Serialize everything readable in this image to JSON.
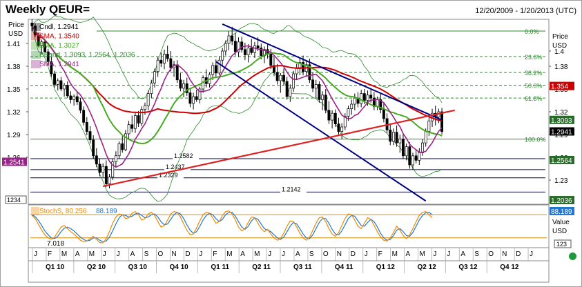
{
  "header": {
    "title": "Weekly QEUR=",
    "date_range": "12/20/2009 - 1/20/2013 (UTC)"
  },
  "colors": {
    "candles": "#000000",
    "sma_red": "#cc0000",
    "sma_green": "#44aa22",
    "sma_purple": "#992288",
    "bollinger": "#2a8a2a",
    "channel": "#000080",
    "trendline": "#dd2222",
    "fib_line": "#2a8a2a",
    "stoch_k": "#ee8800",
    "stoch_d": "#2277cc",
    "status_dot": "#1e9a3a"
  },
  "chart_data": [
    {
      "type": "line",
      "name": "price",
      "title": "Weekly QEUR=",
      "ylabel": "Price USD",
      "ylim": [
        1.2,
        1.44
      ],
      "yticks": [
        "1.41",
        "1.38",
        "1.35",
        "1.32",
        "1.29",
        "1.26"
      ],
      "yticks_right": [
        "1.4",
        "1.38",
        "1.35",
        "1.32",
        "1.29",
        "1.26",
        "1.23"
      ],
      "legend": [
        {
          "label": "Cndl, 1.2941",
          "color": "#000000"
        },
        {
          "label": "SMA, 1.3540",
          "color": "#cc0000"
        },
        {
          "label": "SMA, 1.3027",
          "color": "#44aa22"
        },
        {
          "label": "BBand, 1.3093, 1.2564, 1.2036",
          "color": "#2a8a2a"
        },
        {
          "label": "SMA, 1.2941",
          "color": "#992288"
        }
      ],
      "fibonacci": [
        {
          "label": "0.0%",
          "value": 1.4264
        },
        {
          "label": "23.6%",
          "value": 1.3927
        },
        {
          "label": "38.2%",
          "value": 1.3718
        },
        {
          "label": "50.0%",
          "value": 1.3549
        },
        {
          "label": "61.8%",
          "value": 1.3381
        },
        {
          "label": "100.0%",
          "value": 1.284
        }
      ],
      "support_levels": [
        {
          "label": "1.2582",
          "value": 1.2582
        },
        {
          "label": "1.2437",
          "value": 1.2437
        },
        {
          "label": "1.2329",
          "value": 1.2329
        },
        {
          "label": "1.2142",
          "value": 1.2142
        }
      ],
      "right_badges": [
        {
          "label": "1.354",
          "value": 1.354,
          "bg": "#cc0000",
          "fg": "#ffffff"
        },
        {
          "label": "1.3093",
          "value": 1.3093,
          "bg": "#2a6a2a",
          "fg": "#ffffff"
        },
        {
          "label": "1.2941",
          "value": 1.2941,
          "bg": "#000000",
          "fg": "#ffffff"
        },
        {
          "label": "1.2564",
          "value": 1.2564,
          "bg": "#2a6a2a",
          "fg": "#ffffff"
        },
        {
          "label": "1.2036",
          "value": 1.2036,
          "bg": "#2a6a2a",
          "fg": "#ffffff"
        }
      ],
      "left_badge": {
        "label": "1.2541",
        "value": 1.2541
      },
      "corner_box": "1234",
      "candles": [
        [
          1.437,
          1.442,
          1.425,
          1.433
        ],
        [
          1.433,
          1.436,
          1.418,
          1.421
        ],
        [
          1.421,
          1.424,
          1.405,
          1.407
        ],
        [
          1.407,
          1.415,
          1.396,
          1.412
        ],
        [
          1.412,
          1.416,
          1.396,
          1.399
        ],
        [
          1.399,
          1.403,
          1.382,
          1.386
        ],
        [
          1.386,
          1.392,
          1.366,
          1.37
        ],
        [
          1.37,
          1.374,
          1.352,
          1.356
        ],
        [
          1.356,
          1.364,
          1.348,
          1.361
        ],
        [
          1.361,
          1.366,
          1.347,
          1.35
        ],
        [
          1.35,
          1.358,
          1.34,
          1.355
        ],
        [
          1.355,
          1.36,
          1.338,
          1.341
        ],
        [
          1.341,
          1.347,
          1.331,
          1.336
        ],
        [
          1.336,
          1.343,
          1.328,
          1.34
        ],
        [
          1.34,
          1.346,
          1.329,
          1.333
        ],
        [
          1.333,
          1.338,
          1.318,
          1.322
        ],
        [
          1.322,
          1.327,
          1.302,
          1.306
        ],
        [
          1.306,
          1.313,
          1.289,
          1.294
        ],
        [
          1.294,
          1.301,
          1.278,
          1.283
        ],
        [
          1.283,
          1.289,
          1.258,
          1.262
        ],
        [
          1.262,
          1.272,
          1.247,
          1.251
        ],
        [
          1.251,
          1.258,
          1.235,
          1.24
        ],
        [
          1.24,
          1.252,
          1.234,
          1.248
        ],
        [
          1.248,
          1.256,
          1.221,
          1.225
        ],
        [
          1.225,
          1.238,
          1.219,
          1.234
        ],
        [
          1.234,
          1.258,
          1.23,
          1.254
        ],
        [
          1.254,
          1.268,
          1.248,
          1.262
        ],
        [
          1.262,
          1.281,
          1.258,
          1.278
        ],
        [
          1.278,
          1.288,
          1.266,
          1.27
        ],
        [
          1.27,
          1.296,
          1.268,
          1.291
        ],
        [
          1.291,
          1.308,
          1.284,
          1.303
        ],
        [
          1.303,
          1.315,
          1.293,
          1.298
        ],
        [
          1.298,
          1.319,
          1.292,
          1.315
        ],
        [
          1.315,
          1.321,
          1.3,
          1.305
        ],
        [
          1.305,
          1.327,
          1.301,
          1.323
        ],
        [
          1.323,
          1.332,
          1.316,
          1.328
        ],
        [
          1.328,
          1.348,
          1.322,
          1.344
        ],
        [
          1.344,
          1.362,
          1.338,
          1.358
        ],
        [
          1.358,
          1.377,
          1.352,
          1.373
        ],
        [
          1.373,
          1.392,
          1.366,
          1.388
        ],
        [
          1.388,
          1.398,
          1.379,
          1.384
        ],
        [
          1.384,
          1.402,
          1.376,
          1.396
        ],
        [
          1.396,
          1.407,
          1.386,
          1.39
        ],
        [
          1.39,
          1.4,
          1.373,
          1.378
        ],
        [
          1.378,
          1.387,
          1.366,
          1.382
        ],
        [
          1.382,
          1.388,
          1.358,
          1.362
        ],
        [
          1.362,
          1.371,
          1.347,
          1.351
        ],
        [
          1.351,
          1.362,
          1.339,
          1.357
        ],
        [
          1.357,
          1.365,
          1.341,
          1.345
        ],
        [
          1.345,
          1.351,
          1.326,
          1.331
        ],
        [
          1.331,
          1.345,
          1.323,
          1.34
        ],
        [
          1.34,
          1.349,
          1.333,
          1.336
        ],
        [
          1.336,
          1.353,
          1.331,
          1.35
        ],
        [
          1.35,
          1.368,
          1.345,
          1.365
        ],
        [
          1.365,
          1.376,
          1.352,
          1.357
        ],
        [
          1.357,
          1.372,
          1.352,
          1.369
        ],
        [
          1.369,
          1.385,
          1.362,
          1.381
        ],
        [
          1.381,
          1.389,
          1.366,
          1.371
        ],
        [
          1.371,
          1.393,
          1.368,
          1.388
        ],
        [
          1.388,
          1.404,
          1.381,
          1.4
        ],
        [
          1.4,
          1.414,
          1.394,
          1.41
        ],
        [
          1.41,
          1.426,
          1.401,
          1.42
        ],
        [
          1.42,
          1.432,
          1.408,
          1.413
        ],
        [
          1.413,
          1.424,
          1.394,
          1.399
        ],
        [
          1.399,
          1.418,
          1.392,
          1.412
        ],
        [
          1.412,
          1.419,
          1.398,
          1.402
        ],
        [
          1.402,
          1.411,
          1.388,
          1.395
        ],
        [
          1.395,
          1.409,
          1.385,
          1.404
        ],
        [
          1.404,
          1.416,
          1.395,
          1.398
        ],
        [
          1.398,
          1.412,
          1.391,
          1.407
        ],
        [
          1.407,
          1.418,
          1.4,
          1.404
        ],
        [
          1.404,
          1.41,
          1.389,
          1.394
        ],
        [
          1.394,
          1.406,
          1.384,
          1.402
        ],
        [
          1.402,
          1.41,
          1.39,
          1.396
        ],
        [
          1.396,
          1.403,
          1.376,
          1.381
        ],
        [
          1.381,
          1.392,
          1.367,
          1.372
        ],
        [
          1.372,
          1.383,
          1.356,
          1.361
        ],
        [
          1.361,
          1.371,
          1.345,
          1.368
        ],
        [
          1.368,
          1.377,
          1.355,
          1.36
        ],
        [
          1.36,
          1.366,
          1.336,
          1.34
        ],
        [
          1.34,
          1.356,
          1.333,
          1.351
        ],
        [
          1.351,
          1.374,
          1.346,
          1.37
        ],
        [
          1.37,
          1.383,
          1.362,
          1.377
        ],
        [
          1.377,
          1.391,
          1.368,
          1.385
        ],
        [
          1.385,
          1.394,
          1.368,
          1.373
        ],
        [
          1.373,
          1.388,
          1.366,
          1.382
        ],
        [
          1.382,
          1.39,
          1.358,
          1.362
        ],
        [
          1.362,
          1.372,
          1.346,
          1.351
        ],
        [
          1.351,
          1.362,
          1.338,
          1.356
        ],
        [
          1.356,
          1.36,
          1.332,
          1.336
        ],
        [
          1.336,
          1.347,
          1.322,
          1.342
        ],
        [
          1.342,
          1.35,
          1.318,
          1.322
        ],
        [
          1.322,
          1.334,
          1.304,
          1.309
        ],
        [
          1.309,
          1.322,
          1.298,
          1.318
        ],
        [
          1.318,
          1.323,
          1.3,
          1.304
        ],
        [
          1.304,
          1.312,
          1.29,
          1.294
        ],
        [
          1.294,
          1.305,
          1.284,
          1.3
        ],
        [
          1.3,
          1.318,
          1.296,
          1.314
        ],
        [
          1.314,
          1.328,
          1.308,
          1.324
        ],
        [
          1.324,
          1.336,
          1.316,
          1.33
        ],
        [
          1.33,
          1.344,
          1.322,
          1.338
        ],
        [
          1.338,
          1.346,
          1.326,
          1.331
        ],
        [
          1.331,
          1.349,
          1.326,
          1.344
        ],
        [
          1.344,
          1.35,
          1.33,
          1.335
        ],
        [
          1.335,
          1.348,
          1.328,
          1.342
        ],
        [
          1.342,
          1.351,
          1.332,
          1.338
        ],
        [
          1.338,
          1.346,
          1.322,
          1.327
        ],
        [
          1.327,
          1.34,
          1.322,
          1.336
        ],
        [
          1.336,
          1.344,
          1.318,
          1.323
        ],
        [
          1.323,
          1.332,
          1.306,
          1.311
        ],
        [
          1.311,
          1.318,
          1.292,
          1.296
        ],
        [
          1.296,
          1.304,
          1.276,
          1.281
        ],
        [
          1.281,
          1.298,
          1.276,
          1.293
        ],
        [
          1.293,
          1.302,
          1.274,
          1.279
        ],
        [
          1.279,
          1.29,
          1.266,
          1.284
        ],
        [
          1.284,
          1.292,
          1.258,
          1.262
        ],
        [
          1.262,
          1.278,
          1.256,
          1.274
        ],
        [
          1.274,
          1.28,
          1.245,
          1.25
        ],
        [
          1.25,
          1.266,
          1.244,
          1.262
        ],
        [
          1.262,
          1.27,
          1.252,
          1.256
        ],
        [
          1.256,
          1.272,
          1.25,
          1.266
        ],
        [
          1.266,
          1.284,
          1.262,
          1.279
        ],
        [
          1.279,
          1.298,
          1.274,
          1.294
        ],
        [
          1.294,
          1.312,
          1.288,
          1.308
        ],
        [
          1.308,
          1.324,
          1.3,
          1.318
        ],
        [
          1.318,
          1.328,
          1.302,
          1.313
        ],
        [
          1.313,
          1.324,
          1.305,
          1.32
        ],
        [
          1.32,
          1.325,
          1.29,
          1.294
        ]
      ],
      "annotations": [
        "0.0%",
        "23.6%",
        "38.2%",
        "50.0%",
        "61.8%",
        "100.0%",
        "1.2582",
        "1.2437",
        "1.2329",
        "1.2142"
      ]
    },
    {
      "type": "line",
      "name": "stochastic",
      "legend": [
        {
          "label": "StochS, 80.256",
          "color": "#ee8800"
        },
        {
          "label": "88.189",
          "color": "#2277cc"
        }
      ],
      "ylim": [
        0,
        100
      ],
      "levels": [
        80,
        20
      ],
      "min_label": "7.018",
      "right_badge": "88.189",
      "right_labels": [
        "Value",
        "USD"
      ],
      "right_corner": "123",
      "k_values": [
        78,
        70,
        55,
        40,
        28,
        20,
        16,
        22,
        35,
        48,
        52,
        44,
        36,
        30,
        22,
        14,
        10,
        12,
        18,
        24,
        16,
        8,
        7,
        18,
        36,
        58,
        74,
        82,
        80,
        70,
        72,
        84,
        88,
        80,
        66,
        70,
        82,
        86,
        78,
        62,
        48,
        52,
        66,
        82,
        88,
        86,
        74,
        56,
        40,
        28,
        30,
        46,
        64,
        80,
        86,
        84,
        72,
        58,
        62,
        78,
        88,
        90,
        82,
        66,
        48,
        38,
        44,
        60,
        74,
        72,
        58,
        44,
        36,
        42,
        30,
        20,
        14,
        18,
        32,
        50,
        64,
        62,
        48,
        32,
        20,
        14,
        22,
        40,
        58,
        72,
        74,
        62,
        44,
        30,
        24,
        34,
        52,
        70,
        82,
        80,
        66,
        50,
        44,
        58,
        72,
        68,
        52,
        36,
        22,
        14,
        12,
        20,
        34,
        50,
        40,
        26,
        18,
        28,
        44,
        62,
        78,
        86,
        88,
        80,
        72
      ],
      "d_values": [
        80,
        75,
        65,
        52,
        38,
        28,
        20,
        18,
        24,
        36,
        45,
        48,
        44,
        38,
        30,
        22,
        16,
        12,
        14,
        20,
        20,
        14,
        10,
        12,
        22,
        38,
        56,
        72,
        80,
        78,
        74,
        76,
        82,
        84,
        78,
        72,
        74,
        80,
        82,
        74,
        62,
        54,
        56,
        68,
        80,
        86,
        82,
        70,
        54,
        40,
        32,
        36,
        50,
        66,
        78,
        84,
        80,
        70,
        62,
        68,
        80,
        86,
        86,
        76,
        62,
        48,
        42,
        50,
        64,
        72,
        68,
        56,
        44,
        40,
        36,
        28,
        20,
        16,
        22,
        36,
        50,
        60,
        56,
        44,
        30,
        20,
        18,
        28,
        44,
        60,
        70,
        70,
        58,
        42,
        30,
        28,
        38,
        54,
        70,
        78,
        76,
        64,
        52,
        50,
        60,
        68,
        62,
        48,
        32,
        20,
        14,
        16,
        26,
        40,
        44,
        36,
        26,
        24,
        34,
        50,
        66,
        78,
        85,
        86,
        80
      ]
    }
  ],
  "x_axis": {
    "months": [
      "J",
      "F",
      "M",
      "A",
      "M",
      "J",
      "J",
      "A",
      "S",
      "O",
      "N",
      "D",
      "J",
      "F",
      "M",
      "A",
      "M",
      "J",
      "J",
      "A",
      "S",
      "O",
      "N",
      "D",
      "J",
      "F",
      "M",
      "A",
      "M",
      "J",
      "J",
      "A",
      "S",
      "O",
      "N",
      "D",
      "J"
    ],
    "quarters": [
      "Q1 10",
      "Q2 10",
      "Q3 10",
      "Q4 10",
      "Q1 11",
      "Q2 11",
      "Q3 11",
      "Q4 11",
      "Q1 12",
      "Q2 12",
      "Q3 12",
      "Q4 12"
    ]
  }
}
